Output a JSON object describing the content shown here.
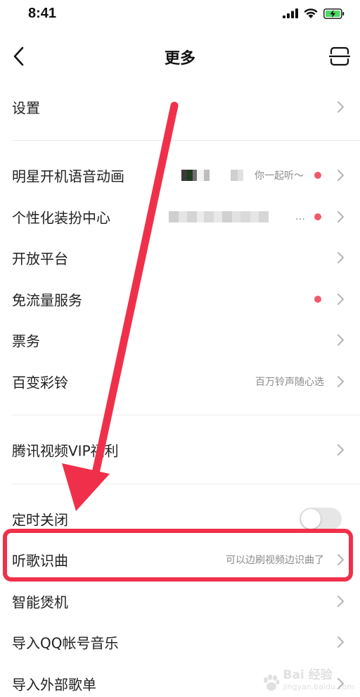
{
  "status_bar": {
    "time": "8:41"
  },
  "nav": {
    "title": "更多",
    "back_icon": "chevron-left-icon",
    "scan_icon": "scan-icon"
  },
  "rows": [
    {
      "label": "设置"
    },
    {
      "label": "明星开机语音动画",
      "hint": "你一起听～",
      "has_dot": true
    },
    {
      "label": "个性化装扮中心",
      "hint": "…",
      "has_dot": true
    },
    {
      "label": "开放平台"
    },
    {
      "label": "免流量服务",
      "has_dot": true
    },
    {
      "label": "票务"
    },
    {
      "label": "百变彩铃",
      "hint": "百万铃声随心选"
    },
    {
      "label": "腾讯视频VIP福利"
    },
    {
      "label": "定时关闭",
      "toggle_on": false
    },
    {
      "label": "听歌识曲",
      "hint": "可以边刷视频边识曲了"
    },
    {
      "label": "智能煲机"
    },
    {
      "label": "导入QQ帐号音乐"
    },
    {
      "label": "导入外部歌单"
    }
  ],
  "watermark": {
    "text": "Bai 经验",
    "sub": "jingyan.baidu.com"
  },
  "colors": {
    "accent_red": "#f0304a",
    "dot_red": "#f0596b",
    "battery_green": "#4cd964"
  }
}
